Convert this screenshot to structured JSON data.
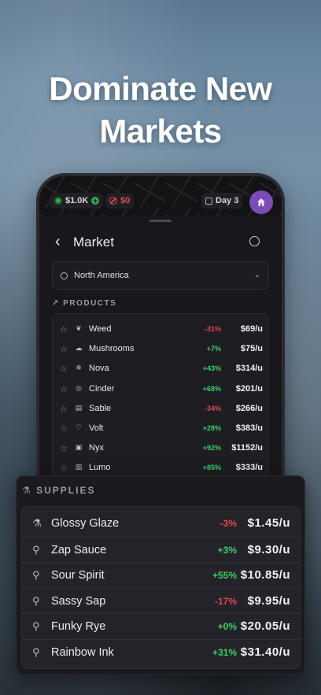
{
  "headline": {
    "line1": "Dominate New",
    "line2": "Markets"
  },
  "status": {
    "cash": "$1.0K",
    "debt": "$0",
    "day": "Day 3"
  },
  "nav": {
    "title": "Market"
  },
  "region": {
    "selected": "North America"
  },
  "products": {
    "label": "PRODUCTS",
    "items": [
      {
        "name": "Weed",
        "change": "-31%",
        "price": "$69/u",
        "icon": "leaf-icon",
        "trend": "down"
      },
      {
        "name": "Mushrooms",
        "change": "+7%",
        "price": "$75/u",
        "icon": "cloud-icon",
        "trend": "up"
      },
      {
        "name": "Nova",
        "change": "+43%",
        "price": "$314/u",
        "icon": "snowflake-icon",
        "trend": "up"
      },
      {
        "name": "Cinder",
        "change": "+68%",
        "price": "$201/u",
        "icon": "target-icon",
        "trend": "up"
      },
      {
        "name": "Sable",
        "change": "-34%",
        "price": "$266/u",
        "icon": "pill-icon",
        "trend": "down"
      },
      {
        "name": "Volt",
        "change": "+28%",
        "price": "$383/u",
        "icon": "heart-pulse-icon",
        "trend": "up"
      },
      {
        "name": "Nyx",
        "change": "+92%",
        "price": "$1152/u",
        "icon": "battery-icon",
        "trend": "up"
      },
      {
        "name": "Lumo",
        "change": "+85%",
        "price": "$333/u",
        "icon": "bottle-icon",
        "trend": "up"
      }
    ]
  },
  "supplies": {
    "label": "SUPPLIES",
    "items": [
      {
        "name": "Glossy Glaze",
        "change": "-3%",
        "price": "$1.45/u",
        "icon": "flask-icon",
        "trend": "down"
      },
      {
        "name": "Zap Sauce",
        "change": "+3%",
        "price": "$9.30/u",
        "icon": "microscope-icon",
        "trend": "up"
      },
      {
        "name": "Sour Spirit",
        "change": "+55%",
        "price": "$10.85/u",
        "icon": "microscope-icon",
        "trend": "up"
      },
      {
        "name": "Sassy Sap",
        "change": "-17%",
        "price": "$9.95/u",
        "icon": "microscope-icon",
        "trend": "down"
      },
      {
        "name": "Funky Rye",
        "change": "+0%",
        "price": "$20.05/u",
        "icon": "microscope-icon",
        "trend": "up"
      },
      {
        "name": "Rainbow Ink",
        "change": "+31%",
        "price": "$31.40/u",
        "icon": "microscope-icon",
        "trend": "up"
      }
    ]
  },
  "colors": {
    "up": "#3ecf6a",
    "down": "#e04a4a",
    "accent": "#7b4bb8"
  }
}
